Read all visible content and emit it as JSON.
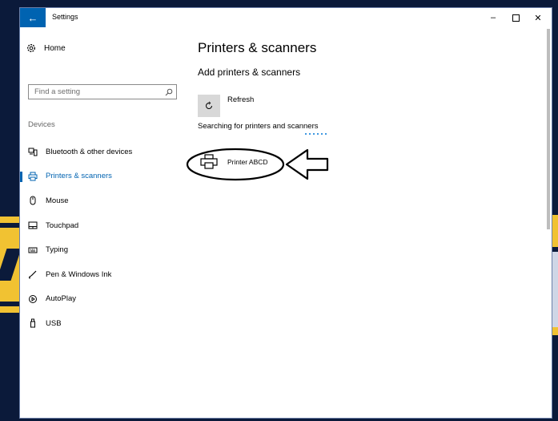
{
  "window": {
    "title": "Settings",
    "back_icon": "arrow-left-icon",
    "controls": {
      "minimize": "–",
      "close": "✕"
    }
  },
  "sidebar": {
    "home_label": "Home",
    "search_placeholder": "Find a setting",
    "section_label": "Devices",
    "items": [
      {
        "label": "Bluetooth & other devices",
        "icon": "bluetooth-devices-icon",
        "active": false
      },
      {
        "label": "Printers & scanners",
        "icon": "printer-icon",
        "active": true
      },
      {
        "label": "Mouse",
        "icon": "mouse-icon",
        "active": false
      },
      {
        "label": "Touchpad",
        "icon": "touchpad-icon",
        "active": false
      },
      {
        "label": "Typing",
        "icon": "keyboard-icon",
        "active": false
      },
      {
        "label": "Pen & Windows Ink",
        "icon": "pen-icon",
        "active": false
      },
      {
        "label": "AutoPlay",
        "icon": "autoplay-icon",
        "active": false
      },
      {
        "label": "USB",
        "icon": "usb-icon",
        "active": false
      }
    ]
  },
  "main": {
    "page_title": "Printers & scanners",
    "section_title": "Add printers & scanners",
    "refresh_label": "Refresh",
    "status_text": "Searching for printers and scanners",
    "found_printer": "Printer ABCD"
  },
  "colors": {
    "accent": "#0063b1",
    "annotation": "#000000"
  }
}
